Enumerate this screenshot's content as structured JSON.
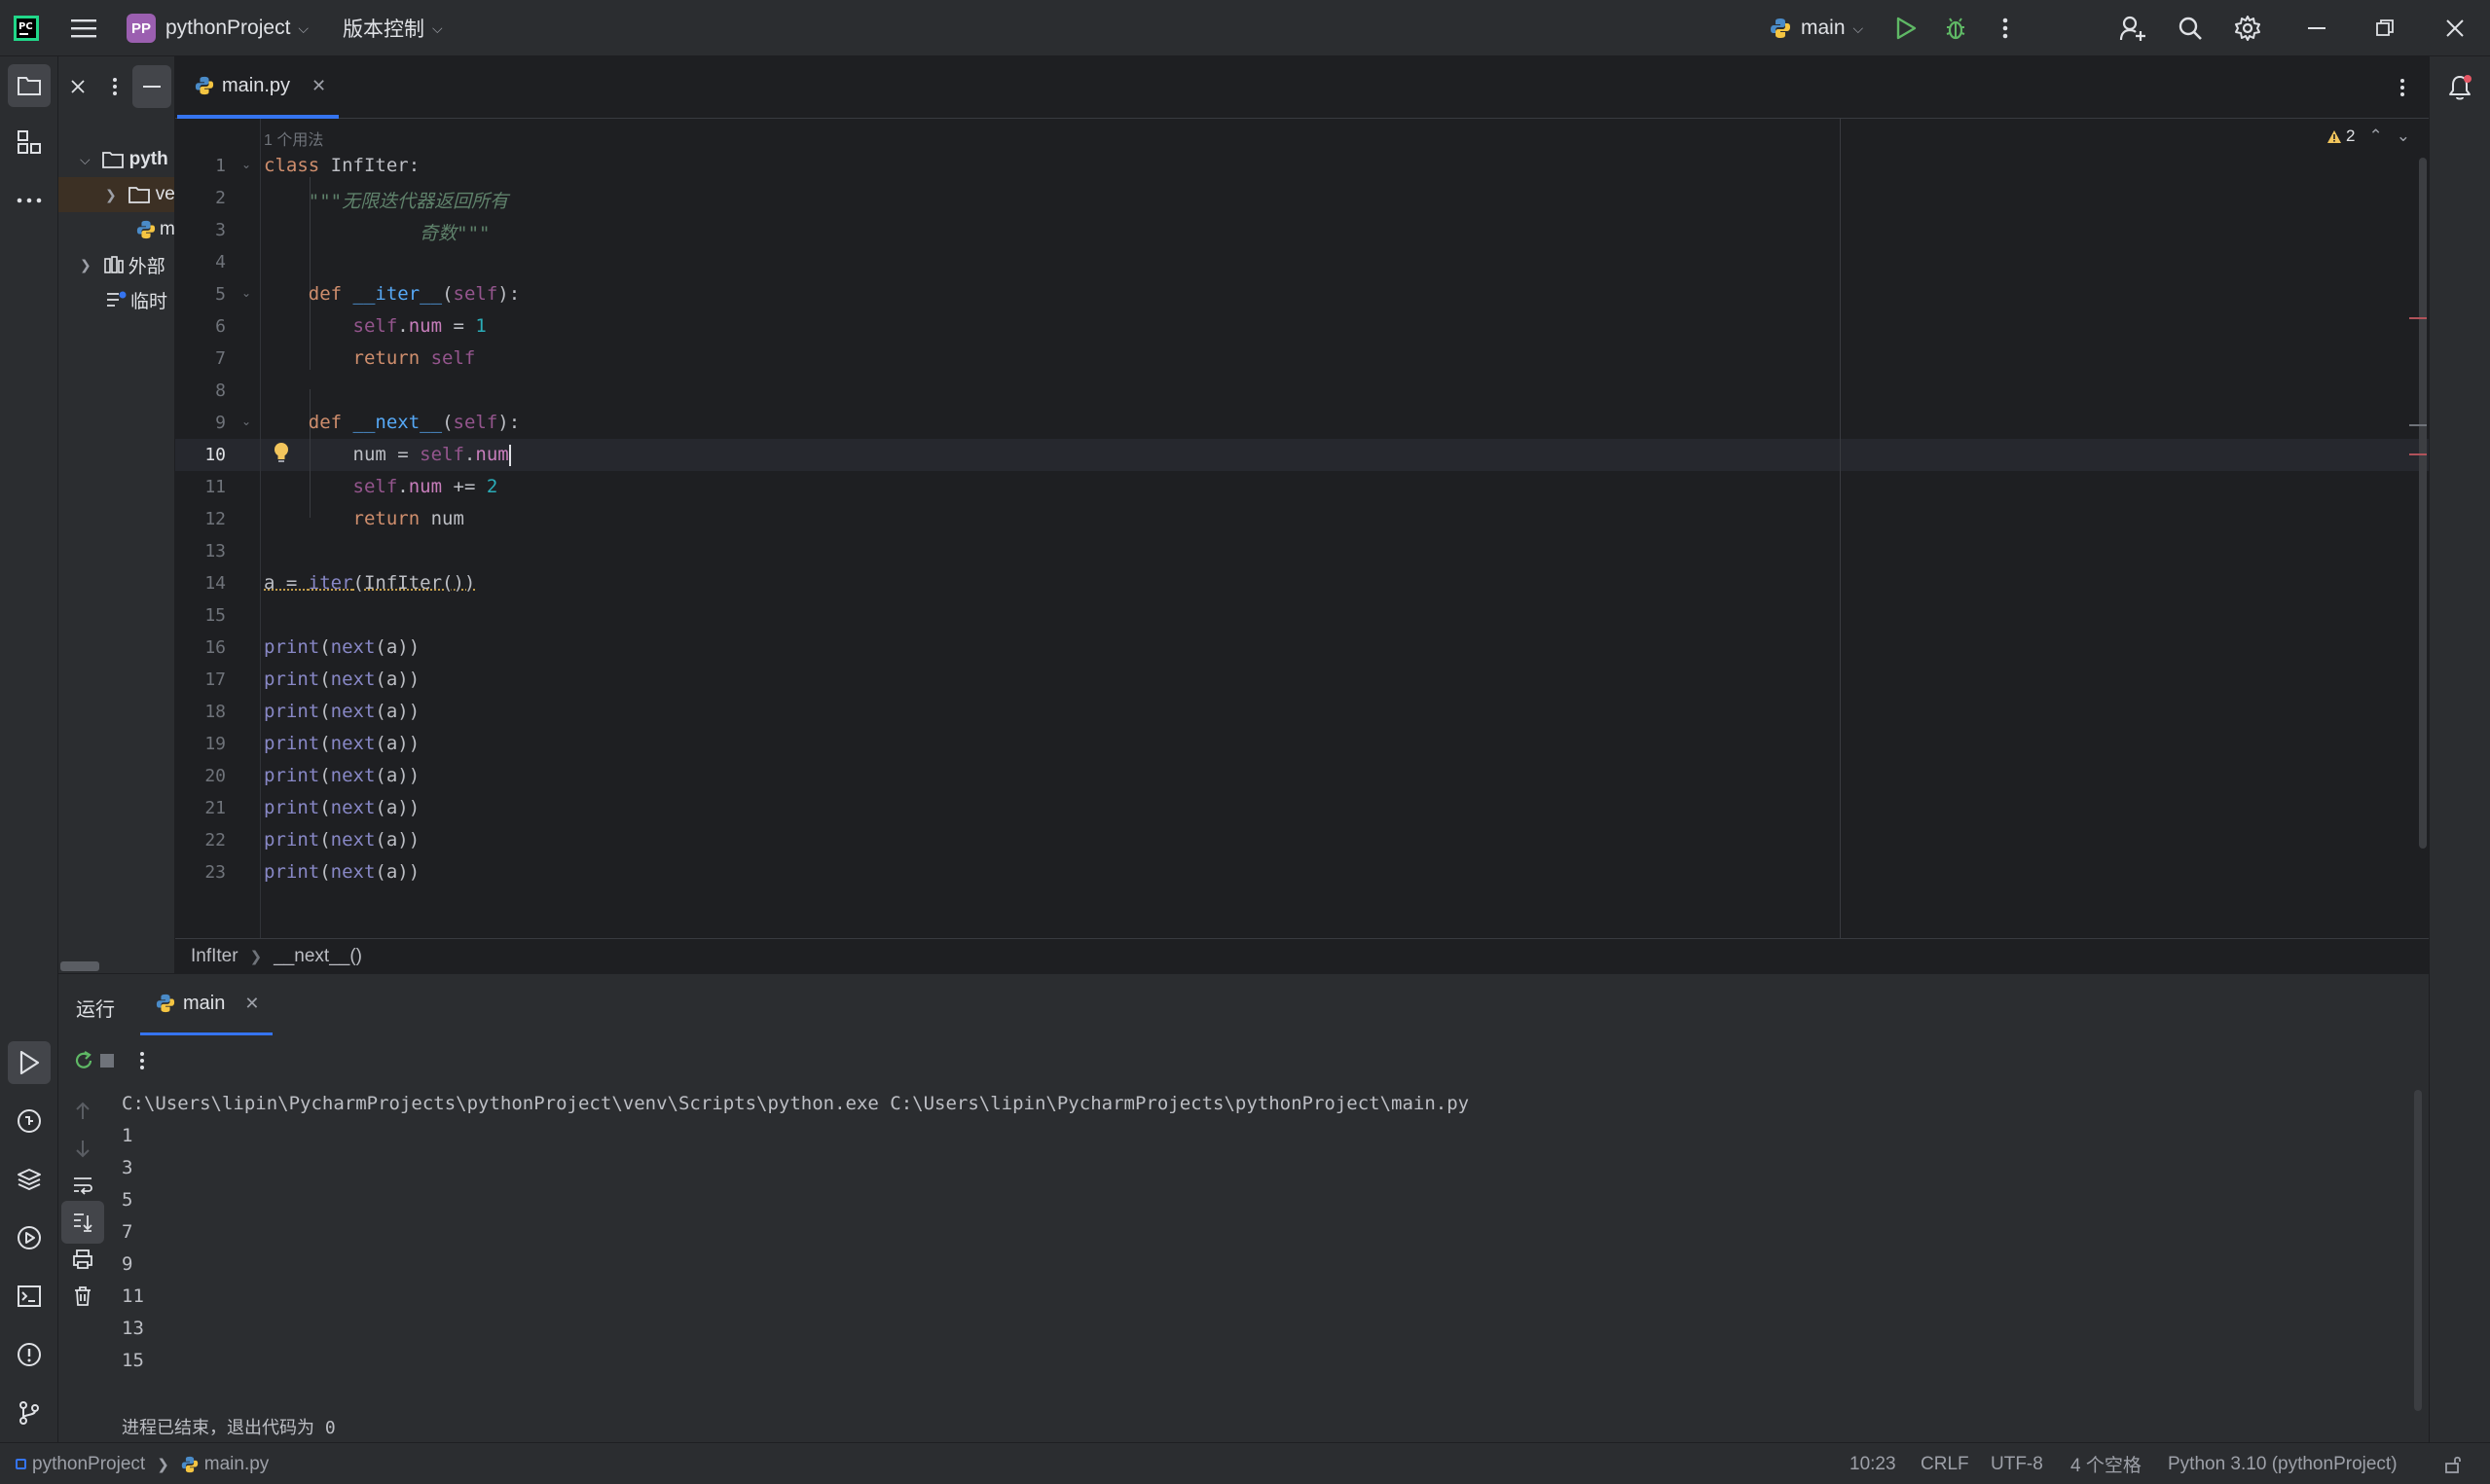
{
  "titlebar": {
    "project_badge": "PP",
    "project_name": "pythonProject",
    "vcs_menu": "版本控制",
    "run_config": "main"
  },
  "project_tree": {
    "items": [
      {
        "label": "pyth"
      },
      {
        "label": "ve"
      },
      {
        "label": "m"
      },
      {
        "label": "外部"
      },
      {
        "label": "临时"
      }
    ]
  },
  "editor": {
    "tab_label": "main.py",
    "usage_hint": "1 个用法",
    "problems_count": "2",
    "line_numbers": [
      "1",
      "2",
      "3",
      "4",
      "5",
      "6",
      "7",
      "8",
      "9",
      "10",
      "11",
      "12",
      "13",
      "14",
      "15",
      "16",
      "17",
      "18",
      "19",
      "20",
      "21",
      "22",
      "23"
    ],
    "breadcrumb": [
      "InfIter",
      "__next__()"
    ]
  },
  "run_panel": {
    "title": "运行",
    "tab_label": "main",
    "command": "C:\\Users\\lipin\\PycharmProjects\\pythonProject\\venv\\Scripts\\python.exe C:\\Users\\lipin\\PycharmProjects\\pythonProject\\main.py",
    "outputs": [
      "1",
      "3",
      "5",
      "7",
      "9",
      "11",
      "13",
      "15"
    ],
    "exit_message": "进程已结束，退出代码为 0"
  },
  "statusbar": {
    "project": "pythonProject",
    "file": "main.py",
    "position": "10:23",
    "line_ending": "CRLF",
    "encoding": "UTF-8",
    "indent": "4 个空格",
    "interpreter": "Python 3.10 (pythonProject)"
  },
  "colors": {
    "accent": "#3574f0",
    "background": "#1e1f22",
    "panel": "#2b2d30",
    "run_green": "#5fb865"
  }
}
